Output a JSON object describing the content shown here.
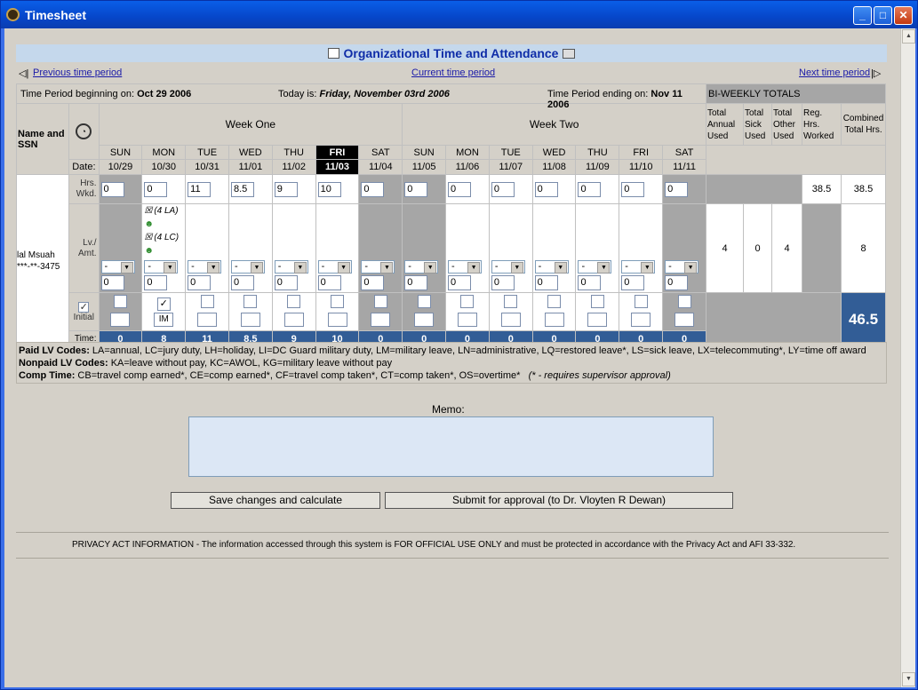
{
  "window": {
    "title": "Timesheet"
  },
  "header": {
    "title": "Organizational Time and Attendance"
  },
  "nav": {
    "prev": " Previous time period",
    "current": "Current time period",
    "next": "Next time period "
  },
  "period": {
    "begin_label": "Time Period beginning on:",
    "begin": "Oct 29 2006",
    "today_label": "Today is:",
    "today": "Friday, November 03rd 2006",
    "end_label": "Time Period ending on:",
    "end": "Nov 11 2006",
    "biweekly": "BI-WEEKLY TOTALS"
  },
  "columns": {
    "name_ssn": "Name and SSN",
    "week1": "Week One",
    "week2": "Week Two",
    "tot_annual": "Total Annual Used",
    "tot_sick": "Total Sick Used",
    "tot_other": "Total Other Used",
    "reg_hrs": "Reg. Hrs. Worked",
    "combined": "Combined Total Hrs.",
    "date_label": "Date:"
  },
  "days": [
    {
      "dow": "SUN",
      "date": "10/29",
      "hrs": "0",
      "amt": "0",
      "lv": "-",
      "time": "0",
      "weekend": true
    },
    {
      "dow": "MON",
      "date": "10/30",
      "hrs": "0",
      "amt": "0",
      "lv": "-",
      "time": "8",
      "weekend": false,
      "codes": [
        "(4 LA)",
        "(4 LC)"
      ],
      "checked": true,
      "initial": "IM"
    },
    {
      "dow": "TUE",
      "date": "10/31",
      "hrs": "11",
      "amt": "0",
      "lv": "-",
      "time": "11",
      "weekend": false
    },
    {
      "dow": "WED",
      "date": "11/01",
      "hrs": "8.5",
      "amt": "0",
      "lv": "-",
      "time": "8.5",
      "weekend": false
    },
    {
      "dow": "THU",
      "date": "11/02",
      "hrs": "9",
      "amt": "0",
      "lv": "-",
      "time": "9",
      "weekend": false
    },
    {
      "dow": "FRI",
      "date": "11/03",
      "hrs": "10",
      "amt": "0",
      "lv": "-",
      "time": "10",
      "weekend": false,
      "today": true
    },
    {
      "dow": "SAT",
      "date": "11/04",
      "hrs": "0",
      "amt": "0",
      "lv": "-",
      "time": "0",
      "weekend": true
    },
    {
      "dow": "SUN",
      "date": "11/05",
      "hrs": "0",
      "amt": "0",
      "lv": "-",
      "time": "0",
      "weekend": true
    },
    {
      "dow": "MON",
      "date": "11/06",
      "hrs": "0",
      "amt": "0",
      "lv": "-",
      "time": "0",
      "weekend": false
    },
    {
      "dow": "TUE",
      "date": "11/07",
      "hrs": "0",
      "amt": "0",
      "lv": "-",
      "time": "0",
      "weekend": false
    },
    {
      "dow": "WED",
      "date": "11/08",
      "hrs": "0",
      "amt": "0",
      "lv": "-",
      "time": "0",
      "weekend": false
    },
    {
      "dow": "THU",
      "date": "11/09",
      "hrs": "0",
      "amt": "0",
      "lv": "-",
      "time": "0",
      "weekend": false
    },
    {
      "dow": "FRI",
      "date": "11/10",
      "hrs": "0",
      "amt": "0",
      "lv": "-",
      "time": "0",
      "weekend": false
    },
    {
      "dow": "SAT",
      "date": "11/11",
      "hrs": "0",
      "amt": "0",
      "lv": "-",
      "time": "0",
      "weekend": true
    }
  ],
  "employee": {
    "name": "lal Msuah",
    "ssn": "***-**-3475"
  },
  "rows": {
    "hrs_label": "Hrs. Wkd.",
    "lv_label": "Lv./ Amt.",
    "initial_label": "Initial",
    "time_label": "Time:"
  },
  "totals": {
    "reg_hrs": "38.5",
    "combined_hrs": "38.5",
    "annual": "4",
    "sick": "0",
    "other": "4",
    "combined_lv": "8",
    "grand": "46.5"
  },
  "codes": {
    "paid_label": "Paid LV Codes:",
    "paid": " LA=annual, LC=jury duty, LH=holiday, LI=DC Guard military duty, LM=military leave, LN=administrative, LQ=restored leave*, LS=sick leave, LX=telecommuting*, LY=time off award",
    "nonpaid_label": "Nonpaid LV Codes:",
    "nonpaid": " KA=leave without pay, KC=AWOL, KG=military leave without pay",
    "comp_label": "Comp Time:",
    "comp": " CB=travel comp earned*, CE=comp earned*, CF=travel comp taken*, CT=comp taken*, OS=overtime*",
    "note": "(* - requires supervisor approval)"
  },
  "memo": {
    "label": "Memo:",
    "value": ""
  },
  "buttons": {
    "save": "Save changes and calculate",
    "submit": "Submit for approval (to Dr. Vloyten R Dewan)"
  },
  "privacy": "PRIVACY ACT INFORMATION - The information accessed through this system is FOR OFFICIAL USE ONLY and must be protected in accordance with the Privacy Act and AFI 33-332."
}
